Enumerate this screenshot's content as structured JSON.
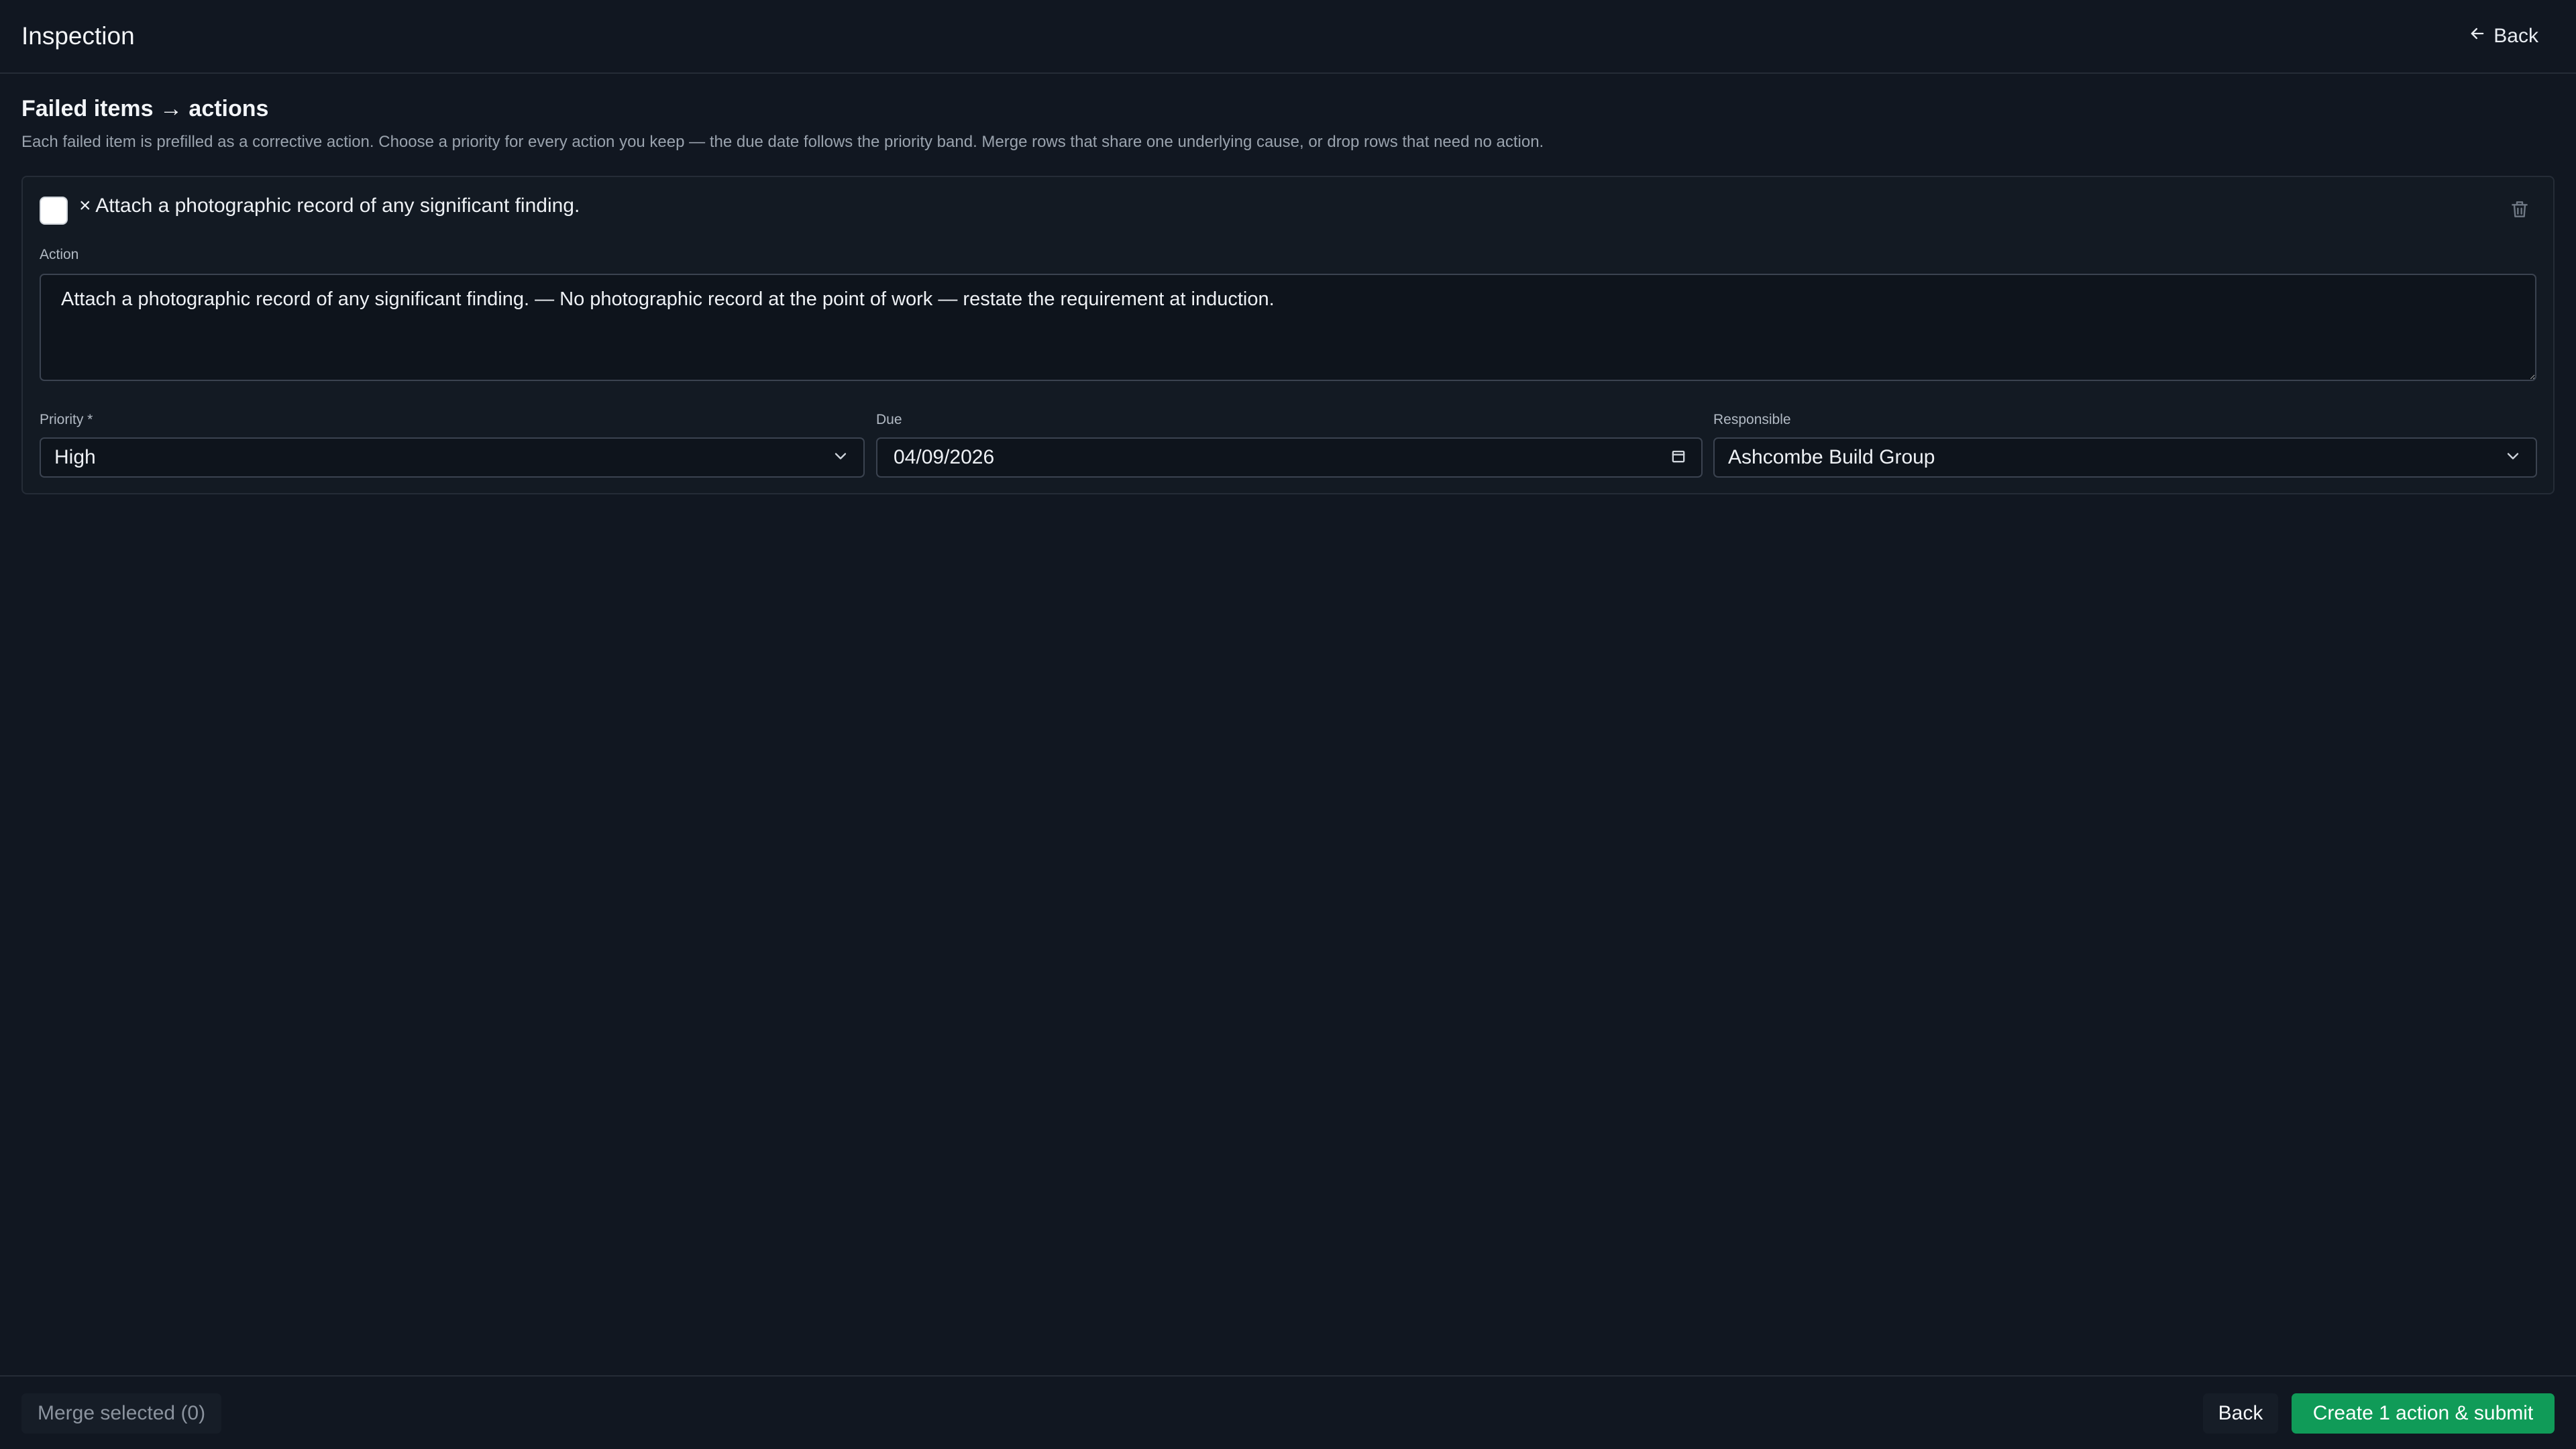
{
  "header": {
    "title": "Inspection",
    "back_label": "Back",
    "back_icon": "arrow-left-icon"
  },
  "section": {
    "title": "Failed items → actions",
    "description": "Each failed item is prefilled as a corrective action. Choose a priority for every action you keep — the due date follows the priority band. Merge rows that share one underlying cause, or drop rows that need no action."
  },
  "item": {
    "selected": false,
    "title": "× Attach a photographic record of any significant finding.",
    "delete_icon": "trash-icon",
    "action_label": "Action",
    "action_value": "Attach a photographic record of any significant finding. — No photographic record at the point of work — restate the requirement at induction.",
    "priority_label": "Priority *",
    "priority_value": "High",
    "due_label": "Due",
    "due_value": "04/09/2026",
    "responsible_label": "Responsible",
    "responsible_value": "Ashcombe Build Group"
  },
  "footer": {
    "merge_label": "Merge selected (0)",
    "back_label": "Back",
    "submit_label": "Create 1 action & submit"
  },
  "colors": {
    "background": "#111721",
    "border": "#252c37",
    "submit": "#109b58"
  }
}
